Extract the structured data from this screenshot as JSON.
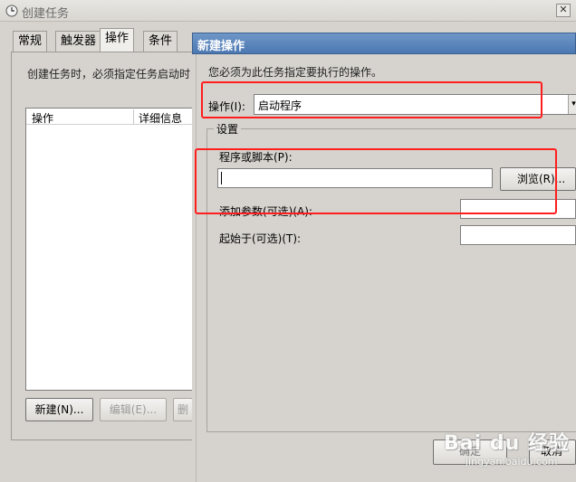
{
  "back_window": {
    "title": "创建任务",
    "close_symbol": "✕",
    "tabs": [
      {
        "label": "常规"
      },
      {
        "label": "触发器"
      },
      {
        "label": "操作"
      },
      {
        "label": "条件"
      }
    ],
    "description": "创建任务时，必须指定任务启动时",
    "list_columns": {
      "action": "操作",
      "detail": "详细信息"
    },
    "buttons": {
      "new": "新建(N)...",
      "edit": "编辑(E)...",
      "delete": "删"
    }
  },
  "dialog": {
    "title": "新建操作",
    "description": "您必须为此任务指定要执行的操作。",
    "action_label": "操作(I):",
    "action_value": "启动程序",
    "action_arrow": "▾",
    "settings_legend": "设置",
    "program_label": "程序或脚本(P):",
    "program_value": "",
    "browse_label": "浏览(R)...",
    "args_label": "添加参数(可选)(A):",
    "args_value": "",
    "startin_label": "起始于(可选)(T):",
    "startin_value": "",
    "ok_label": "确定",
    "cancel_label": "取消"
  },
  "watermark": {
    "brand": "Bai du 经验",
    "sub": "jingyan.baidu.com"
  },
  "colors": {
    "annotation": "#ff1e1e",
    "dialog_title_bg": "#5581ba"
  }
}
